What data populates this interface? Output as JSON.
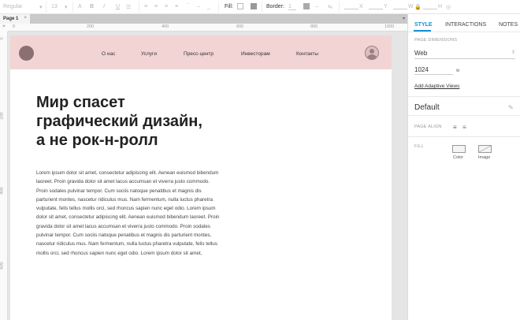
{
  "toolbar": {
    "font_style": "Regular",
    "font_size": "13",
    "fill_label": "Fill:",
    "border_label": "Border:",
    "border_value": "1",
    "x_label": "X",
    "y_label": "Y",
    "w_label": "W",
    "h_label": "H"
  },
  "tabs": [
    {
      "label": "Page 1",
      "close": "×"
    }
  ],
  "ruler": {
    "top": [
      "0",
      "200",
      "400",
      "600",
      "800",
      "1000"
    ],
    "left": [
      "0",
      "200",
      "400",
      "600"
    ]
  },
  "site": {
    "nav": [
      "О нас",
      "Услуги",
      "Пресс-центр",
      "Инвесторам",
      "Контакты"
    ],
    "headline": [
      "Мир спасет",
      "графический дизайн,",
      "а не рок-н-ролл"
    ],
    "body": [
      "Lorem ipsum dolor sit amet, consectetur adipiscing elit. Aenean euismod bibendum",
      "laoreet. Proin gravida dolor sit amet lacus accumsan et viverra justo commodo.",
      "Proin sodales pulvinar tempor. Cum sociis natoque penatibus et magnis dis",
      "parturient montes, nascetur ridiculus mus. Nam fermentum, nulla luctus pharetra",
      "vulputate, felis tellus mollis orci, sed rhoncus sapien nunc eget odio. Lorem ipsum",
      "dolor sit amet, consectetur adipiscing elit. Aenean euismod bibendum laoreet. Proin",
      "gravida dolor sit amet lacus accumsan et viverra justo commodo. Proin sodales",
      "pulvinar tempor. Cum sociis natoque penatibus et magnis dis parturient montes,",
      "nascetur ridiculus mus. Nam fermentum, nulla luctus pharetra vulputate, felis tellus",
      "mollis orci, sed rhoncus sapien nunc eget odio. Lorem ipsum dolor sit amet,"
    ]
  },
  "panel": {
    "tabs": [
      "STYLE",
      "INTERACTIONS",
      "NOTES"
    ],
    "page_dimensions_label": "PAGE DIMENSIONS",
    "dimension_preset": "Web",
    "width_value": "1024",
    "width_unit": "w",
    "adaptive_link": "Add Adaptive Views",
    "style_name": "Default",
    "page_align_label": "PAGE ALIGN",
    "fill_label": "FILL",
    "fill_color": "Color",
    "fill_image": "Image"
  },
  "colors": {
    "accent": "#1a8fd6",
    "header_bg": "#f2d4d4"
  }
}
